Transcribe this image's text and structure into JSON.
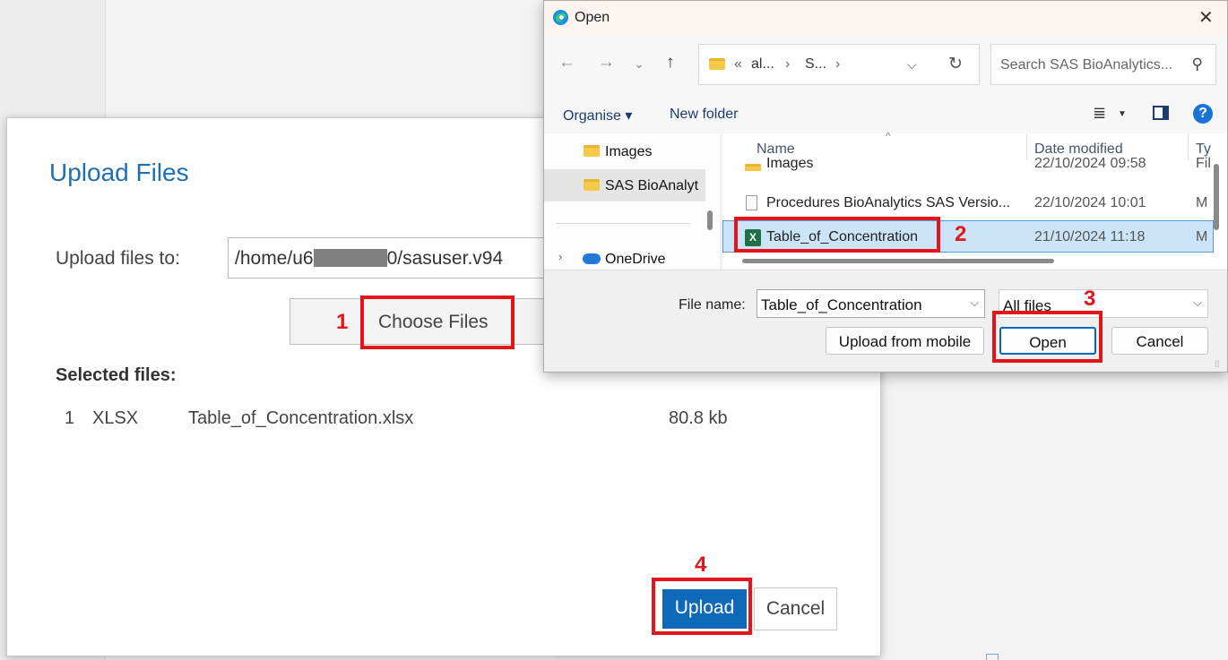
{
  "upload_dialog": {
    "title": "Upload Files",
    "upload_to_label": "Upload files to:",
    "path_prefix": "/home/u6",
    "path_suffix": "0/sasuser.v94",
    "choose_label": "Choose Files",
    "selected_label": "Selected files:",
    "files": [
      {
        "index": "1",
        "type": "XLSX",
        "name": "Table_of_Concentration.xlsx",
        "size": "80.8 kb"
      }
    ],
    "upload_label": "Upload",
    "cancel_label": "Cancel"
  },
  "annotations": {
    "n1": "1",
    "n2": "2",
    "n3": "3",
    "n4": "4",
    "color": "#e3151a"
  },
  "open_dialog": {
    "title": "Open",
    "address": {
      "chevrons": "«",
      "seg1": "al...",
      "sep": "›",
      "seg2": "S...",
      "sep2": "›"
    },
    "search_placeholder": "Search SAS BioAnalytics...",
    "organise_label": "Organise ▾",
    "new_folder_label": "New folder",
    "nav_items": [
      {
        "label": "Images"
      },
      {
        "label": "SAS BioAnalyt"
      },
      {
        "label": "OneDrive"
      }
    ],
    "columns": {
      "name": "Name",
      "date": "Date modified",
      "type": "Ty"
    },
    "rows": [
      {
        "name": "Images",
        "date": "22/10/2024 09:58",
        "type": "Fil"
      },
      {
        "name": "Procedures BioAnalytics SAS Versio...",
        "date": "22/10/2024 10:01",
        "type": "M"
      },
      {
        "name": "Table_of_Concentration",
        "date": "21/10/2024 11:18",
        "type": "M"
      }
    ],
    "file_name_label": "File name:",
    "file_name_value": "Table_of_Concentration",
    "filter_value": "All files",
    "upload_mobile_label": "Upload from mobile",
    "open_label": "Open",
    "cancel_label": "Cancel"
  },
  "colors": {
    "accent_blue": "#0e6ab9",
    "title_blue": "#1f6fb2",
    "selection": "#cce4f7"
  },
  "icons": [
    "edge-icon",
    "close-icon",
    "back-arrow-icon",
    "forward-arrow-icon",
    "recent-dropdown-icon",
    "up-arrow-icon",
    "folder-icon",
    "refresh-icon",
    "search-icon",
    "view-options-icon",
    "preview-pane-icon",
    "help-icon",
    "onedrive-icon",
    "document-icon",
    "excel-icon",
    "chevron-down-icon",
    "resize-grip-icon"
  ]
}
